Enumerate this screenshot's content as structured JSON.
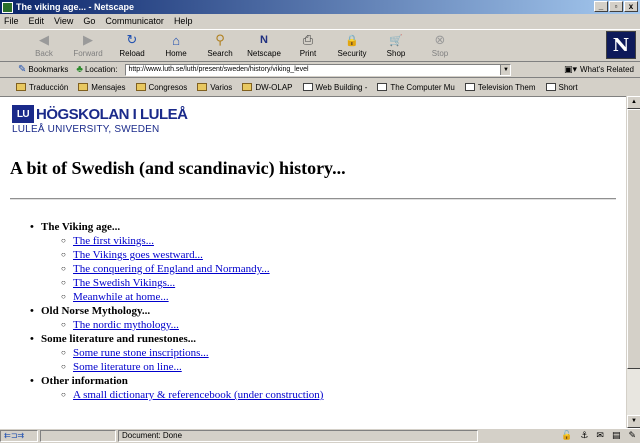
{
  "window": {
    "title": "The viking age... - Netscape",
    "buttons": [
      "_",
      "▫",
      "x"
    ]
  },
  "menu": [
    "File",
    "Edit",
    "View",
    "Go",
    "Communicator",
    "Help"
  ],
  "toolbar": [
    {
      "label": "Back",
      "icon": "◀",
      "disabled": true
    },
    {
      "label": "Forward",
      "icon": "▶",
      "disabled": true
    },
    {
      "label": "Reload",
      "icon": "↻",
      "disabled": false
    },
    {
      "label": "Home",
      "icon": "⌂",
      "disabled": false
    },
    {
      "label": "Search",
      "icon": "⚲",
      "disabled": false
    },
    {
      "label": "Netscape",
      "icon": "N",
      "disabled": false
    },
    {
      "label": "Print",
      "icon": "⎙",
      "disabled": false
    },
    {
      "label": "Security",
      "icon": "🔒",
      "disabled": false
    },
    {
      "label": "Shop",
      "icon": "🛒",
      "disabled": false
    },
    {
      "label": "Stop",
      "icon": "⊗",
      "disabled": true
    }
  ],
  "logo_letter": "N",
  "location": {
    "bookmarks_label": "Bookmarks",
    "location_label": "Location:",
    "url": "http://www.luth.se/luth/present/sweden/history/viking_level",
    "related_label": "What's Related"
  },
  "personal_toolbar": [
    {
      "label": "Traducción",
      "type": "folder"
    },
    {
      "label": "Mensajes",
      "type": "folder"
    },
    {
      "label": "Congresos",
      "type": "folder"
    },
    {
      "label": "Varios",
      "type": "folder"
    },
    {
      "label": "DW-OLAP",
      "type": "folder"
    },
    {
      "label": "Web Building -",
      "type": "doc"
    },
    {
      "label": "The Computer Mu",
      "type": "doc"
    },
    {
      "label": "Television Them",
      "type": "doc"
    },
    {
      "label": "Short",
      "type": "doc"
    }
  ],
  "page": {
    "logo_mark": "LU",
    "logo_name": "HÖGSKOLAN I LULEÅ",
    "logo_sub": "LULEÅ UNIVERSITY, SWEDEN",
    "title": "A bit of Swedish (and scandinavic) history...",
    "sections": [
      {
        "heading": "The Viking age...",
        "links": [
          "The first vikings...",
          "The Vikings goes westward...",
          "The conquering of England and Normandy...",
          "The Swedish Vikings...",
          "Meanwhile at home..."
        ]
      },
      {
        "heading": "Old Norse Mythology...",
        "links": [
          "The nordic mythology..."
        ]
      },
      {
        "heading": "Some literature and runestones...",
        "links": [
          "Some rune stone inscriptions...",
          "Some literature on line..."
        ]
      },
      {
        "heading": "Other information",
        "links": [
          "A small dictionary & referencebook (under construction)"
        ]
      }
    ]
  },
  "status": {
    "text": "Document: Done"
  }
}
